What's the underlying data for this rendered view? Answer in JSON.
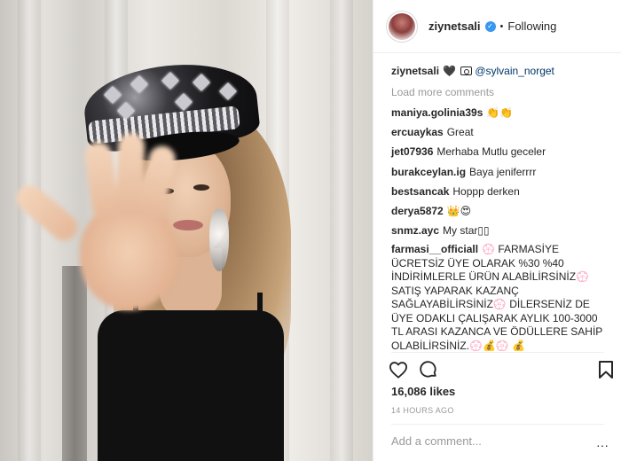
{
  "header": {
    "username": "ziynetsali",
    "verified_glyph": "✓",
    "separator": "•",
    "follow_status": "Following"
  },
  "caption": {
    "username": "ziynetsali",
    "heart": "🖤",
    "mention": "@sylvain_norget"
  },
  "load_more": "Load more comments",
  "comments": [
    {
      "user": "maniya.golinia39s",
      "text": "👏👏"
    },
    {
      "user": "ercuaykas",
      "text": "Great"
    },
    {
      "user": "jet07936",
      "text": "Merhaba Mutlu geceler"
    },
    {
      "user": "burakceylan.ig",
      "text": "Baya jeniferrrr"
    },
    {
      "user": "bestsancak",
      "text": "Hoppp derken"
    },
    {
      "user": "derya5872",
      "text": "👑😍"
    },
    {
      "user": "snmz.ayc",
      "text": "My star▯▯"
    }
  ],
  "long_comment": {
    "user": "farmasi__officiall",
    "text": "💮 FARMASİYE ÜCRETSİZ ÜYE OLARAK %30 %40 İNDİRİMLERLE ÜRÜN ALABİLİRSİNİZ💮 SATIŞ YAPARAK KAZANÇ SAĞLAYABİLİRSİNİZ💮 DİLERSENİZ DE ÜYE ODAKLI ÇALIŞARAK AYLIK 100-3000 TL ARASI KAZANCA VE ÖDÜLLERE SAHİP OLABİLİRSİNİZ.💮💰💮 💰"
  },
  "actions": {
    "like_icon": "heart-icon",
    "comment_icon": "comment-icon",
    "save_icon": "bookmark-icon"
  },
  "likes": "16,086 likes",
  "timestamp": "14 HOURS AGO",
  "comment_box": {
    "placeholder": "Add a comment..."
  },
  "more_glyph": "···",
  "colors": {
    "text": "#262626",
    "muted": "#999999",
    "verified": "#3897f0",
    "mention": "#003569",
    "border": "#efefef"
  }
}
